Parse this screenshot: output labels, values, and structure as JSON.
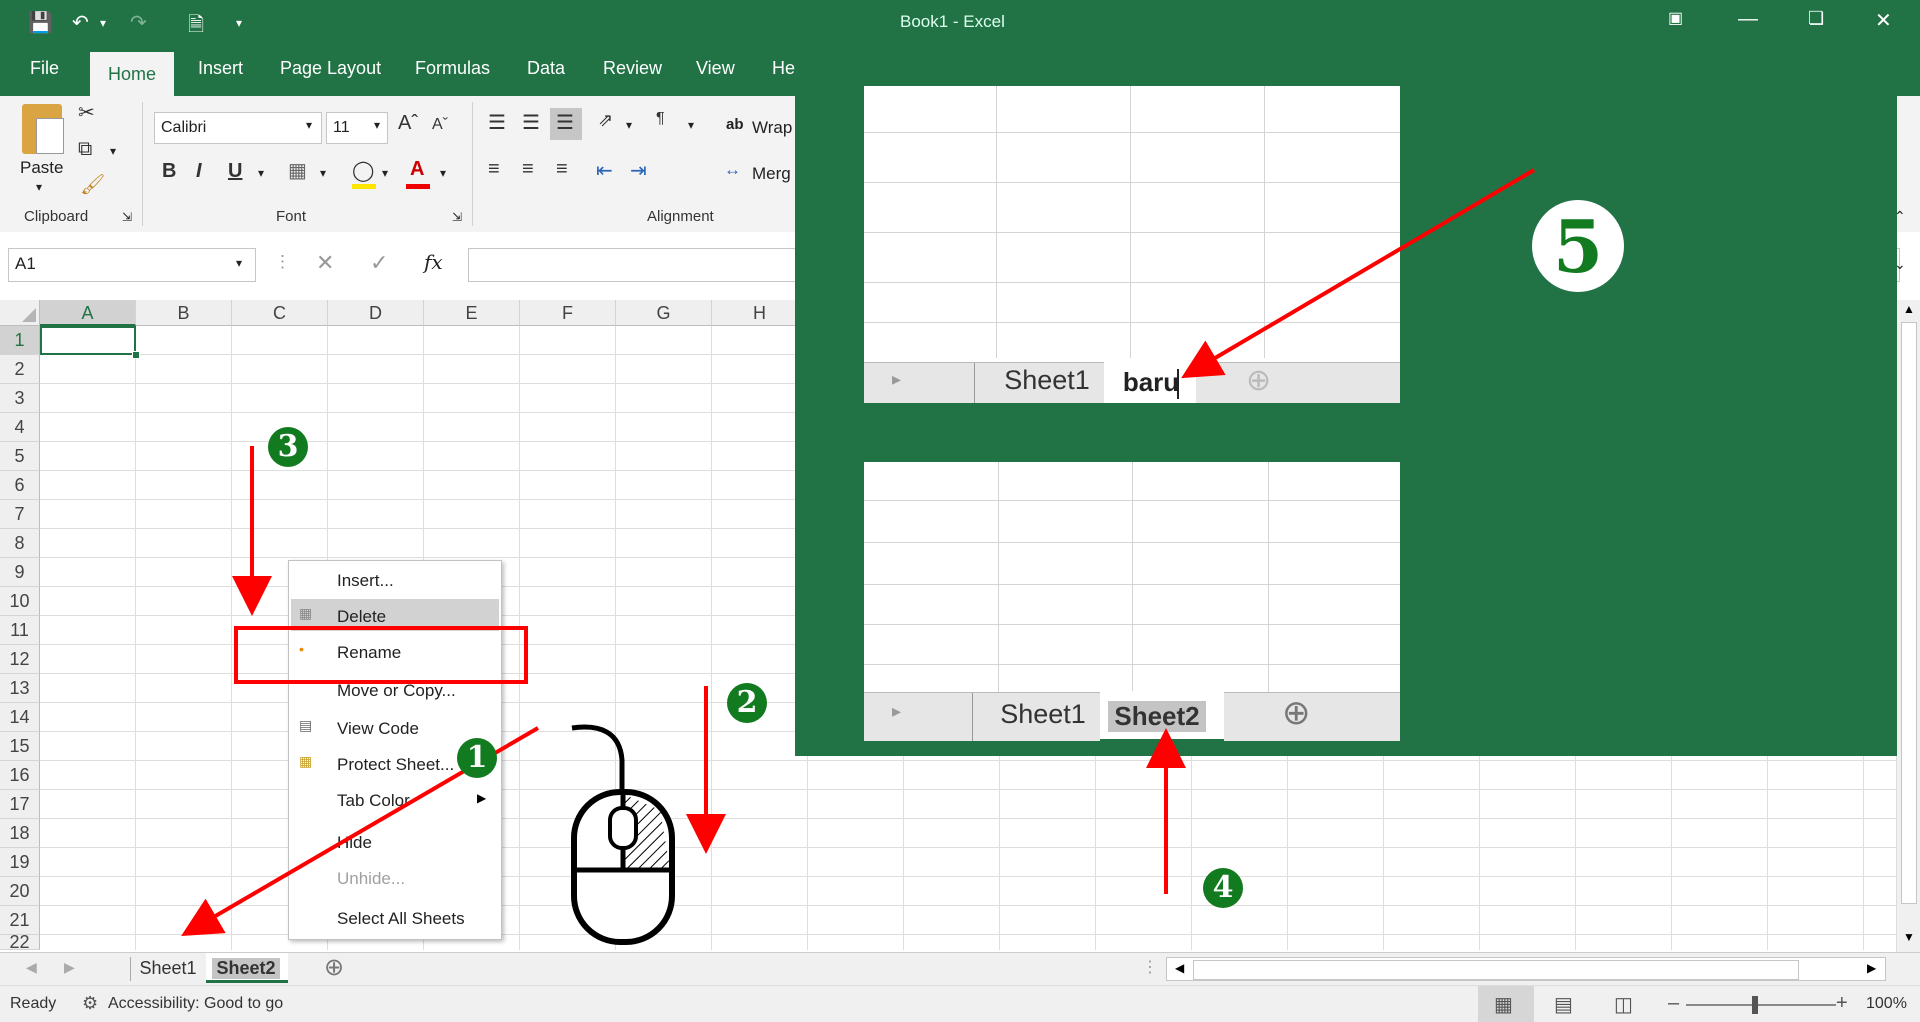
{
  "titlebar": {
    "title": "Book1 - Excel"
  },
  "ribbon_tabs": [
    "File",
    "Home",
    "Insert",
    "Page Layout",
    "Formulas",
    "Data",
    "Review",
    "View",
    "He"
  ],
  "ribbon": {
    "paste_label": "Paste",
    "font_name": "Calibri",
    "font_size": "11",
    "wrap_label": "Wrap",
    "merge_label": "Merg",
    "group_clipboard": "Clipboard",
    "group_font": "Font",
    "group_alignment": "Alignment"
  },
  "formula_bar": {
    "name_box": "A1",
    "fx": "fx",
    "formula": ""
  },
  "columns": [
    "A",
    "B",
    "C",
    "D",
    "E",
    "F",
    "G",
    "H"
  ],
  "rows": [
    "1",
    "2",
    "3",
    "4",
    "5",
    "6",
    "7",
    "8",
    "9",
    "10",
    "11",
    "12",
    "13",
    "14",
    "15",
    "16",
    "17",
    "18",
    "19",
    "20",
    "21",
    "22"
  ],
  "context_menu": {
    "insert": "Insert...",
    "delete": "Delete",
    "rename": "Rename",
    "move_copy": "Move or Copy...",
    "view_code": "View Code",
    "protect": "Protect Sheet...",
    "tab_color": "Tab Color",
    "hide": "Hide",
    "unhide": "Unhide...",
    "select_all": "Select All Sheets"
  },
  "sheet_tabs": [
    "Sheet1",
    "Sheet2"
  ],
  "overlay": {
    "top_panel_tabs": [
      "Sheet1",
      "baru"
    ],
    "bottom_panel_tabs": [
      "Sheet1",
      "Sheet2"
    ]
  },
  "steps": [
    "1",
    "2",
    "3",
    "4",
    "5"
  ],
  "status": {
    "ready": "Ready",
    "accessibility": "Accessibility: Good to go",
    "zoom": "100%"
  },
  "colors": {
    "excel_green": "#217346",
    "annotation_red": "#ff0000",
    "badge_green": "#127a1f"
  }
}
